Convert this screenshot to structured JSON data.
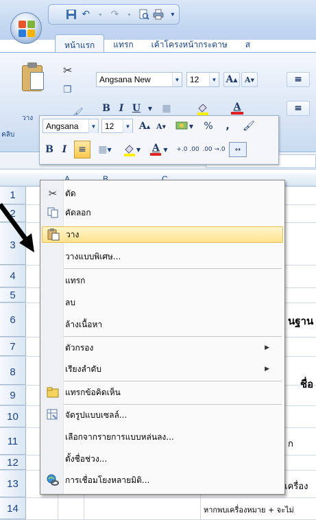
{
  "quick_access": {
    "undo": "↶",
    "redo": "↷"
  },
  "tabs": [
    {
      "label": "หน้าแรก",
      "active": true
    },
    {
      "label": "แทรก"
    },
    {
      "label": "เค้าโครงหน้ากระดาษ"
    },
    {
      "label": "ส"
    }
  ],
  "ribbon": {
    "paste_label": "วาง",
    "clipboard_group_label": "คลิบ",
    "font_name": "Angsana New",
    "font_size": "12",
    "grow_font": "A",
    "shrink_font": "A",
    "bold": "B",
    "italic": "I",
    "underline": "U",
    "font_color": "A"
  },
  "mini_toolbar": {
    "font_name": "Angsana",
    "font_size": "12",
    "grow_font": "A",
    "shrink_font": "A",
    "percent": "%",
    "comma": ",",
    "bold": "B",
    "italic": "I",
    "font_color": "A",
    "increase_decimal": "+.0 .00",
    "decrease_decimal": ".00 →.0"
  },
  "columns": [
    "A",
    "B",
    "C"
  ],
  "rows": [
    {
      "num": "1"
    },
    {
      "num": "2"
    },
    {
      "num": "3"
    },
    {
      "num": "4"
    },
    {
      "num": "5"
    },
    {
      "num": "6"
    },
    {
      "num": "7"
    },
    {
      "num": "8"
    },
    {
      "num": "9"
    },
    {
      "num": "10"
    },
    {
      "num": "11"
    },
    {
      "num": "12"
    },
    {
      "num": "13"
    },
    {
      "num": "14"
    }
  ],
  "cells": {
    "r6": "นฐาน",
    "r8": "ชื่อ",
    "r11": "ก",
    "r13": "ป็นเครื่อง",
    "r14": "หากพบเครื่องหมาย + จะไม่"
  },
  "context_menu": [
    {
      "label": "ตัด",
      "icon": "scissors-icon"
    },
    {
      "label": "คัดลอก",
      "icon": "copy-icon"
    },
    {
      "label": "วาง",
      "icon": "paste-icon",
      "highlighted": true
    },
    {
      "label": "วางแบบพิเศษ..."
    },
    {
      "label": "แทรก"
    },
    {
      "label": "ลบ"
    },
    {
      "label": "ล้างเนื้อหา"
    },
    {
      "label": "ตัวกรอง",
      "submenu": true
    },
    {
      "label": "เรียงลำดับ",
      "submenu": true
    },
    {
      "label": "แทรกข้อคิดเห็น",
      "icon": "comment-icon"
    },
    {
      "label": "จัดรูปแบบเซลล์...",
      "icon": "format-cells-icon"
    },
    {
      "label": "เลือกจากรายการแบบหล่นลง..."
    },
    {
      "label": "ตั้งชื่อช่วง..."
    },
    {
      "label": "การเชื่อมโยงหลายมิติ...",
      "icon": "hyperlink-icon"
    }
  ],
  "colors": {
    "highlight": "#ffe28f",
    "ribbon": "#dde8f6",
    "header_text": "#15428b"
  }
}
